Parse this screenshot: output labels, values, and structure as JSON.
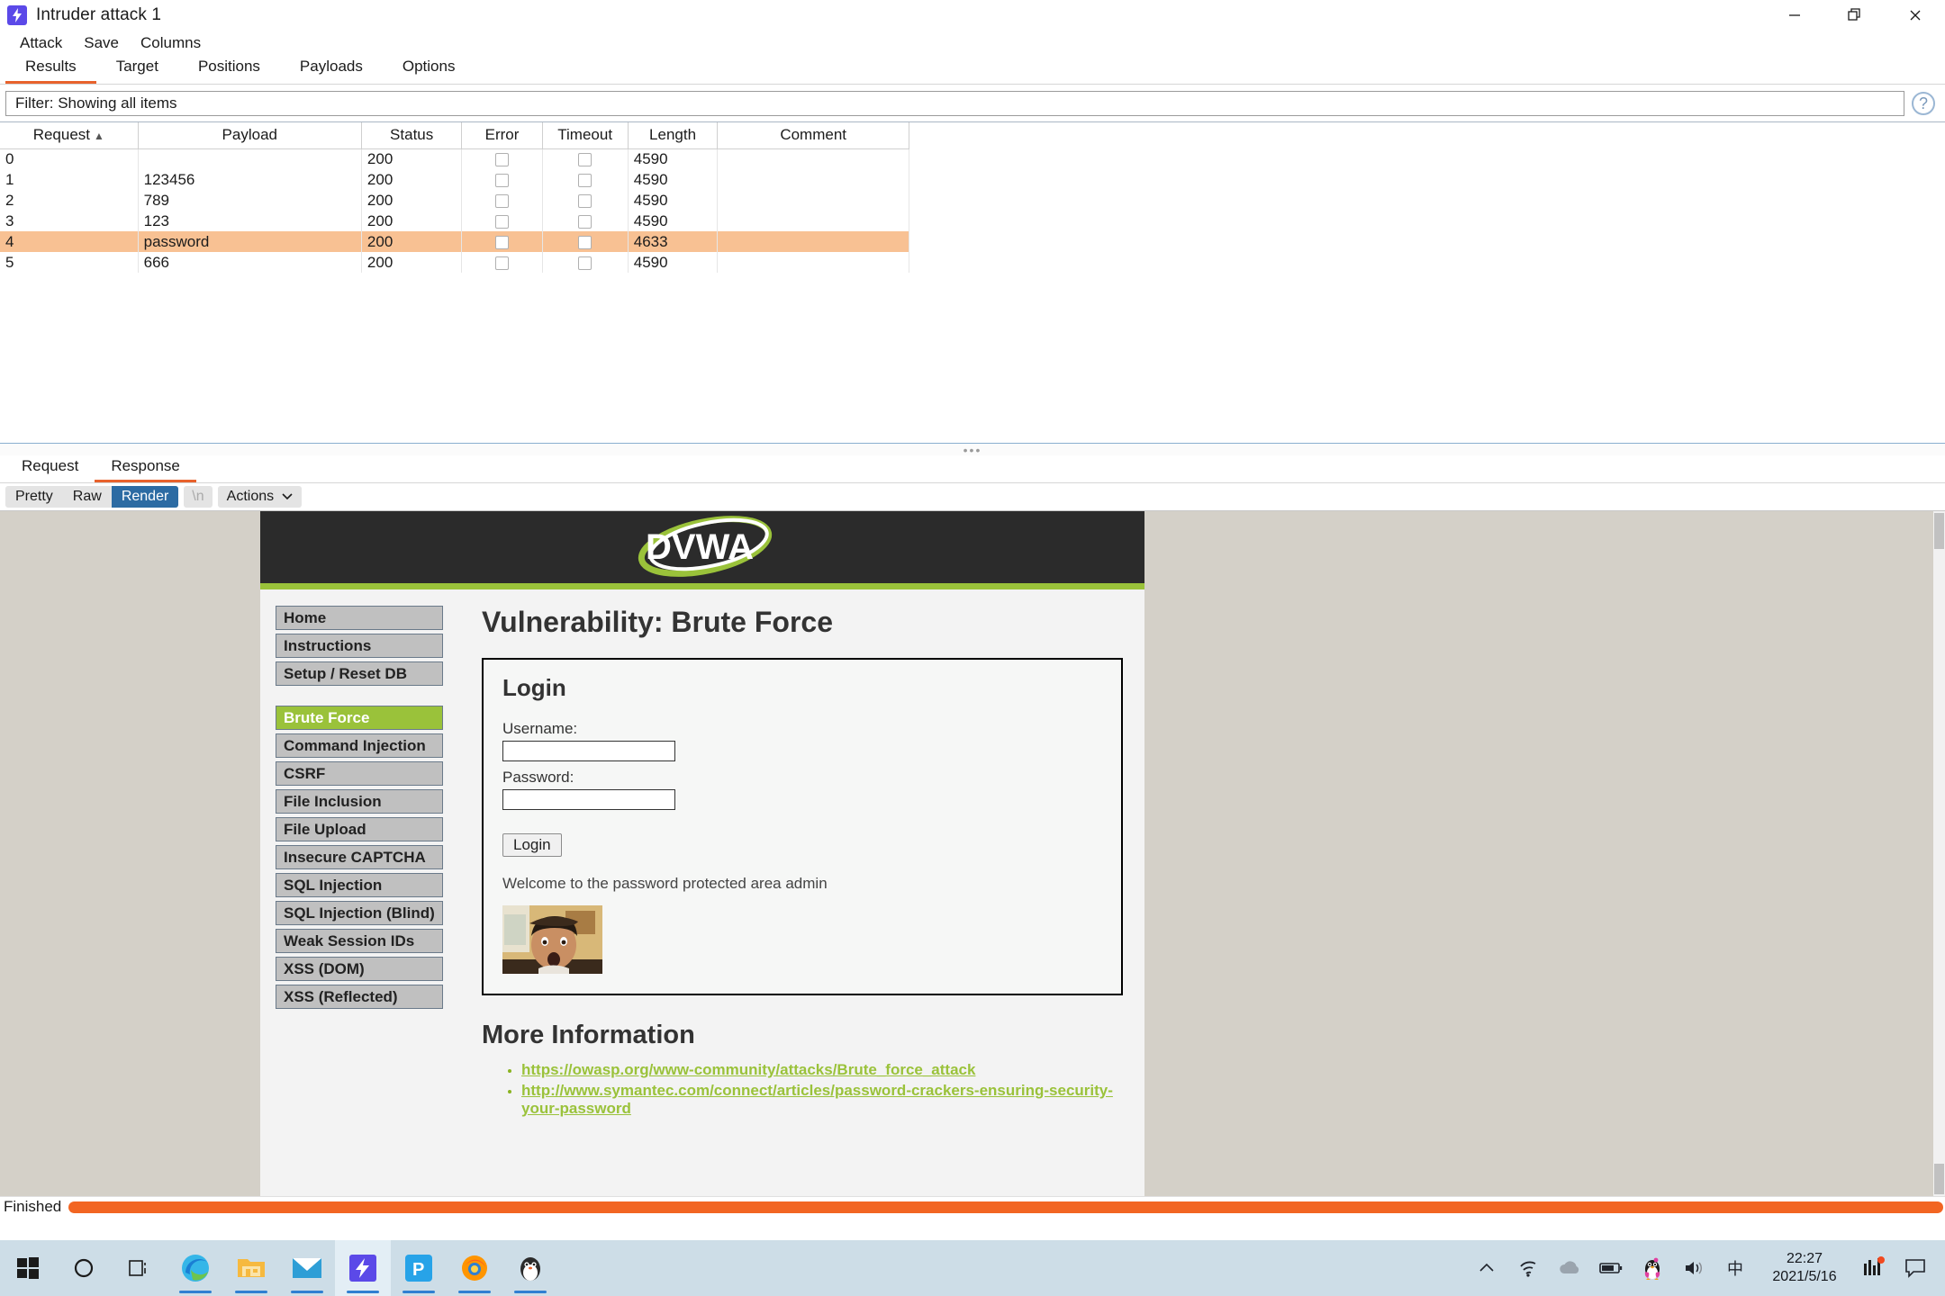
{
  "window": {
    "title": "Intruder attack 1",
    "app_icon": "burp-bolt-icon",
    "controls": {
      "minimize": "minimize-icon",
      "restore": "restore-icon",
      "close": "close-icon"
    }
  },
  "menu": {
    "items": [
      "Attack",
      "Save",
      "Columns"
    ]
  },
  "main_tabs": {
    "items": [
      "Results",
      "Target",
      "Positions",
      "Payloads",
      "Options"
    ],
    "active": "Results"
  },
  "filter": {
    "text": "Filter: Showing all items",
    "help": "?"
  },
  "results_table": {
    "columns": [
      "Request",
      "Payload",
      "Status",
      "Error",
      "Timeout",
      "Length",
      "Comment"
    ],
    "sort_column": "Request",
    "sort_direction": "asc",
    "rows": [
      {
        "request": "0",
        "payload": "",
        "status": "200",
        "error": false,
        "timeout": false,
        "length": "4590",
        "comment": "",
        "highlighted": false
      },
      {
        "request": "1",
        "payload": "123456",
        "status": "200",
        "error": false,
        "timeout": false,
        "length": "4590",
        "comment": "",
        "highlighted": false
      },
      {
        "request": "2",
        "payload": "789",
        "status": "200",
        "error": false,
        "timeout": false,
        "length": "4590",
        "comment": "",
        "highlighted": false
      },
      {
        "request": "3",
        "payload": "123",
        "status": "200",
        "error": false,
        "timeout": false,
        "length": "4590",
        "comment": "",
        "highlighted": false
      },
      {
        "request": "4",
        "payload": "password",
        "status": "200",
        "error": false,
        "timeout": false,
        "length": "4633",
        "comment": "",
        "highlighted": true
      },
      {
        "request": "5",
        "payload": "666",
        "status": "200",
        "error": false,
        "timeout": false,
        "length": "4590",
        "comment": "",
        "highlighted": false
      }
    ],
    "highlight_color": "#f8c193"
  },
  "message_tabs": {
    "items": [
      "Request",
      "Response"
    ],
    "active": "Response"
  },
  "render_toolbar": {
    "view_modes": [
      "Pretty",
      "Raw",
      "Render"
    ],
    "active_mode": "Render",
    "newline_button": "\\n",
    "actions_label": "Actions",
    "active_color": "#2c6ba3"
  },
  "rendered_page": {
    "logo": "DVWA",
    "brand_color": "#9ac23a",
    "header_bg": "#2b2b2b",
    "sidebar": {
      "group1": [
        "Home",
        "Instructions",
        "Setup / Reset DB"
      ],
      "group2": [
        "Brute Force",
        "Command Injection",
        "CSRF",
        "File Inclusion",
        "File Upload",
        "Insecure CAPTCHA",
        "SQL Injection",
        "SQL Injection (Blind)",
        "Weak Session IDs",
        "XSS (DOM)",
        "XSS (Reflected)"
      ],
      "active": "Brute Force"
    },
    "page_title": "Vulnerability: Brute Force",
    "login": {
      "heading": "Login",
      "username_label": "Username:",
      "username_value": "",
      "password_label": "Password:",
      "password_value": "",
      "submit_label": "Login",
      "welcome_message": "Welcome to the password protected area admin",
      "avatar_alt": "user-avatar-photo"
    },
    "more_information": {
      "heading": "More Information",
      "links": [
        "https://owasp.org/www-community/attacks/Brute_force_attack",
        "http://www.symantec.com/connect/articles/password-crackers-ensuring-security-your-password"
      ]
    }
  },
  "status_bar": {
    "text": "Finished",
    "progress_color": "#f26522",
    "progress_percent": 100
  },
  "taskbar": {
    "start": "windows-start-icon",
    "apps": [
      "cortana-search-icon",
      "task-view-icon",
      "microsoft-edge-icon",
      "file-explorer-icon",
      "mail-icon",
      "burp-suite-icon",
      "pycharm-icon",
      "firefox-icon",
      "qq-icon"
    ],
    "active_app": "burp-suite-icon",
    "tray": [
      "show-hidden-icons-chevron",
      "wifi-icon",
      "onedrive-cloud-icon",
      "battery-icon",
      "qq-penguin-icon",
      "volume-icon",
      "ime-chinese-icon"
    ],
    "clock_time": "22:27",
    "clock_date": "2021/5/16",
    "tray_right": [
      "network-monitor-icon",
      "action-center-icon"
    ]
  }
}
